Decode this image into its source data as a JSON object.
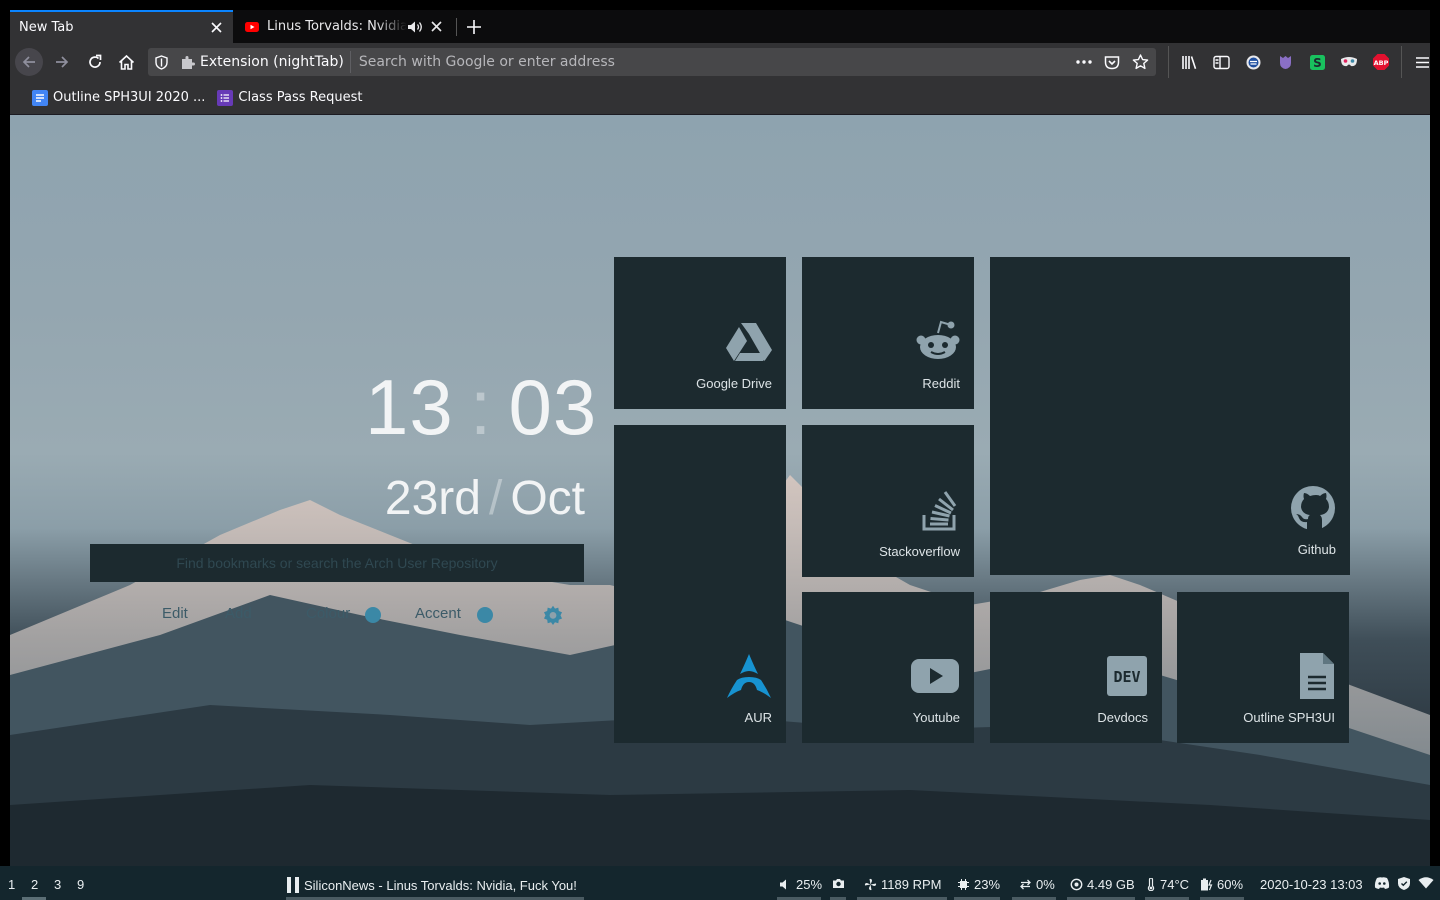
{
  "tabs": {
    "active": {
      "title": "New Tab"
    },
    "inactive": {
      "title": "Linus Torvalds: Nvidia, Fuck You!"
    }
  },
  "urlbar": {
    "extension_label": "Extension (nightTab)",
    "placeholder": "Search with Google or enter address"
  },
  "bookmarks": [
    {
      "label": "Outline SPH3UI 2020 ..."
    },
    {
      "label": "Class Pass Request"
    }
  ],
  "clock": {
    "hours": "13",
    "separator": ":",
    "minutes": "03"
  },
  "date": {
    "day": "23rd",
    "separator": "/",
    "month": "Oct"
  },
  "search": {
    "placeholder": "Find bookmarks or search the Arch User Repository"
  },
  "controls": {
    "edit": "Edit",
    "add": "Add",
    "colour": "Colour",
    "accent": "Accent"
  },
  "tiles": [
    {
      "name": "Google Drive",
      "icon": "google-drive-icon"
    },
    {
      "name": "Reddit",
      "icon": "reddit-icon"
    },
    {
      "name": "Github",
      "icon": "github-icon"
    },
    {
      "name": "AUR",
      "icon": "arch-linux-icon"
    },
    {
      "name": "Stackoverflow",
      "icon": "stackoverflow-icon"
    },
    {
      "name": "Youtube",
      "icon": "youtube-icon"
    },
    {
      "name": "Devdocs",
      "icon": "dev-icon"
    },
    {
      "name": "Outline SPH3UI",
      "icon": "document-icon"
    }
  ],
  "colors": {
    "tile_bg": "#1c2a2f",
    "accent": "#3b88a6",
    "tab_highlight": "#0a84ff",
    "statusbar_bg": "#14262d"
  },
  "statusbar": {
    "workspaces": [
      "1",
      "2",
      "3",
      "9"
    ],
    "media": "SiliconNews - Linus Torvalds: Nvidia, Fuck You!",
    "volume": "25%",
    "fan": "1189 RPM",
    "cpu": "23%",
    "swap": "0%",
    "memory": "4.49 GB",
    "temperature": "74°C",
    "battery": "60%",
    "datetime": "2020-10-23 13:03"
  }
}
